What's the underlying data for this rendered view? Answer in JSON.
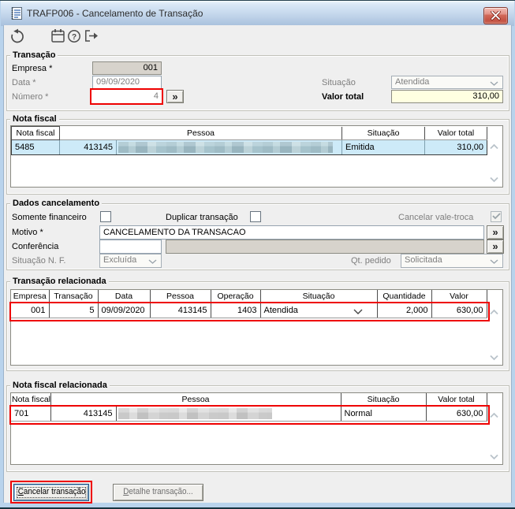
{
  "window": {
    "title": "TRAFP006 - Cancelamento de Transação"
  },
  "symbols": {
    "lookup": "»"
  },
  "transacao": {
    "legend": "Transação",
    "empresa_label": "Empresa *",
    "empresa_value": "001",
    "data_label": "Data *",
    "data_value": "09/09/2020",
    "numero_label": "Número *",
    "numero_value": "4",
    "situacao_label": "Situação",
    "situacao_value": "Atendida",
    "valor_total_label": "Valor total",
    "valor_total_value": "310,00"
  },
  "nota_fiscal": {
    "legend": "Nota fiscal",
    "headers": [
      "Nota fiscal",
      "Pessoa",
      "Situação",
      "Valor total"
    ],
    "row": {
      "nota": "5485",
      "pessoa_codigo": "413145",
      "situacao": "Emitida",
      "valor": "310,00"
    }
  },
  "dados_cancelamento": {
    "legend": "Dados cancelamento",
    "somente_financeiro_label": "Somente financeiro",
    "duplicar_label": "Duplicar transação",
    "cancelar_vale_troca_label": "Cancelar vale-troca",
    "motivo_label": "Motivo *",
    "motivo_value": "CANCELAMENTO DA TRANSACAO",
    "conferencia_label": "Conferência",
    "situacao_nf_label": "Situação N. F.",
    "situacao_nf_value": "Excluída",
    "qt_pedido_label": "Qt. pedido",
    "qt_pedido_value": "Solicitada"
  },
  "transacao_relacionada": {
    "legend": "Transação relacionada",
    "headers": [
      "Empresa",
      "Transação",
      "Data",
      "Pessoa",
      "Operação",
      "Situação",
      "Quantidade",
      "Valor"
    ],
    "row": {
      "empresa": "001",
      "transacao": "5",
      "data": "09/09/2020",
      "pessoa": "413145",
      "operacao": "1403",
      "situacao": "Atendida",
      "quantidade": "2,000",
      "valor": "630,00"
    }
  },
  "nota_fiscal_relacionada": {
    "legend": "Nota fiscal relacionada",
    "headers": [
      "Nota fiscal",
      "Pessoa",
      "Situação",
      "Valor total"
    ],
    "row": {
      "nota": "701",
      "pessoa_codigo": "413145",
      "situacao": "Normal",
      "valor": "630,00"
    }
  },
  "footer": {
    "cancel_button": "Cancelar transação",
    "detail_button": "Detalhe transação..."
  }
}
